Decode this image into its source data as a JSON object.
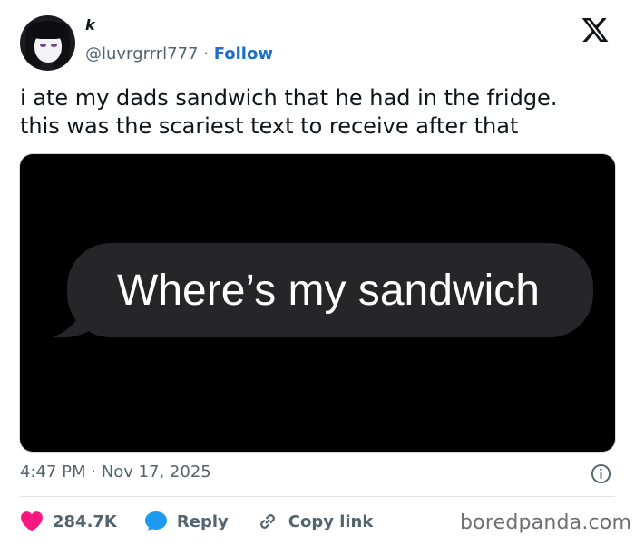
{
  "author": {
    "name": "k",
    "handle": "@luvrgrrrl777",
    "separator": "·",
    "follow_label": "Follow"
  },
  "tweet": {
    "text_line1": "i ate my dads sandwich that he had in the fridge.",
    "text_line2": "this was the scariest text to receive after that"
  },
  "media": {
    "message": "Where’s my sandwich"
  },
  "meta": {
    "time": "4:47 PM",
    "separator": "·",
    "date": "Nov 17, 2025"
  },
  "actions": {
    "likes": "284.7K",
    "reply_label": "Reply",
    "copy_link_label": "Copy link"
  },
  "watermark": "boredpanda.com",
  "colors": {
    "follow": "#1d6ec4",
    "like_heart": "#f91880",
    "reply_bubble": "#1d9bf0",
    "muted_text": "#536471",
    "message_bubble": "#262629"
  },
  "icons": [
    "avatar",
    "x-logo-icon",
    "bubble-tail",
    "info-icon",
    "heart-icon",
    "reply-icon",
    "link-icon"
  ]
}
